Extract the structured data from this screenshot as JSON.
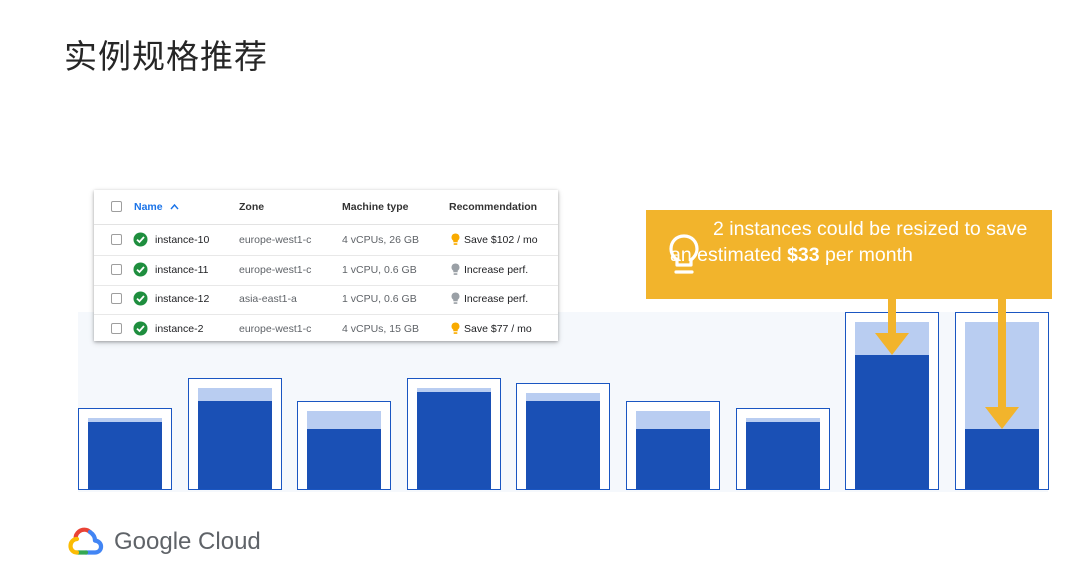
{
  "slide": {
    "title": "实例规格推荐"
  },
  "table": {
    "headers": {
      "name": "Name",
      "zone": "Zone",
      "machine_type": "Machine type",
      "recommendation": "Recommendation"
    },
    "rows": [
      {
        "instance": "instance-10",
        "zone": "europe-west1-c",
        "machine_type": "4 vCPUs, 26 GB",
        "recommendation": "Save $102 / mo",
        "rec_kind": "save"
      },
      {
        "instance": "instance-11",
        "zone": "europe-west1-c",
        "machine_type": "1 vCPU, 0.6 GB",
        "recommendation": "Increase perf.",
        "rec_kind": "increase"
      },
      {
        "instance": "instance-12",
        "zone": "asia-east1-a",
        "machine_type": "1 vCPU, 0.6 GB",
        "recommendation": "Increase perf.",
        "rec_kind": "increase"
      },
      {
        "instance": "instance-2",
        "zone": "europe-west1-c",
        "machine_type": "4 vCPUs, 15 GB",
        "recommendation": "Save $77 / mo",
        "rec_kind": "save"
      }
    ]
  },
  "callout": {
    "text_before": "2 instances could be resized to save an estimated ",
    "highlight": "$33",
    "text_after": " per month"
  },
  "bars": [
    {
      "capacity": 0.46,
      "used": 0.38
    },
    {
      "capacity": 0.63,
      "used": 0.5
    },
    {
      "capacity": 0.5,
      "used": 0.34
    },
    {
      "capacity": 0.63,
      "used": 0.55
    },
    {
      "capacity": 0.6,
      "used": 0.5
    },
    {
      "capacity": 0.5,
      "used": 0.34
    },
    {
      "capacity": 0.46,
      "used": 0.38
    },
    {
      "capacity": 1.0,
      "used": 0.76,
      "resize": true
    },
    {
      "capacity": 1.0,
      "used": 0.34,
      "resize": true
    }
  ],
  "brand": {
    "name": "Google Cloud"
  },
  "colors": {
    "accent_yellow": "#f2b42c",
    "bar_dark": "#1a50b5",
    "bar_light": "#b9cdf1",
    "check_green": "#1e8e3e",
    "save_bulb": "#f9ab00",
    "increase_bulb": "#9aa0a6",
    "link_blue": "#1a73e8"
  }
}
